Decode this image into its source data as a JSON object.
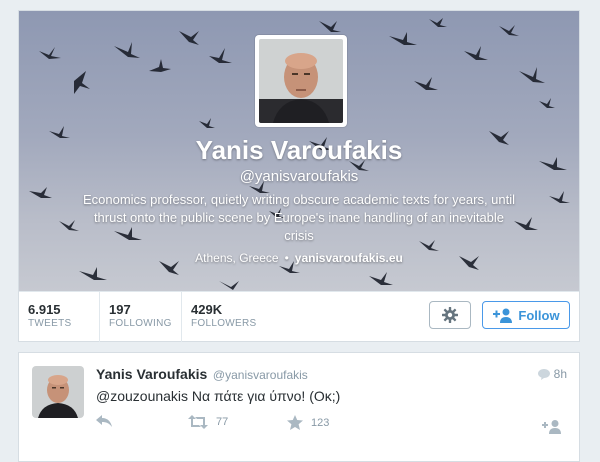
{
  "profile": {
    "name": "Yanis Varoufakis",
    "handle": "@yanisvaroufakis",
    "bio": "Economics professor, quietly writing obscure academic texts for years, until thrust onto the public scene by Europe's inane handling of an inevitable crisis",
    "location": "Athens, Greece",
    "separator": "•",
    "website": "yanisvaroufakis.eu"
  },
  "stats": {
    "tweets": {
      "value": "6.915",
      "label": "TWEETS"
    },
    "following": {
      "value": "197",
      "label": "FOLLOWING"
    },
    "followers": {
      "value": "429K",
      "label": "FOLLOWERS"
    }
  },
  "actions": {
    "settings_icon": "gear-icon",
    "follow_label": "Follow",
    "follow_icon": "add-user-icon"
  },
  "tweet": {
    "name": "Yanis Varoufakis",
    "handle": "@yanisvaroufakis",
    "time": "8h",
    "text": "@zouzounakis Να πάτε για ύπνο! (Οκ;)",
    "retweets": "77",
    "favorites": "123"
  },
  "colors": {
    "accent": "#3b94d9",
    "muted": "#8899a6",
    "text": "#292f33"
  }
}
